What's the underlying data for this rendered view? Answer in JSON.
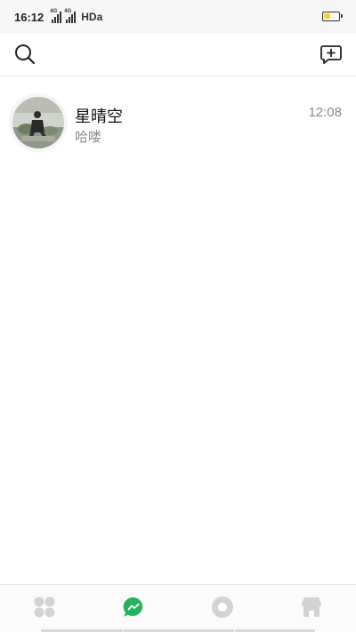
{
  "status_bar": {
    "time": "16:12",
    "network_1": "4G",
    "network_2": "4G",
    "hd_label": "HDa",
    "battery_level": 0.45,
    "battery_color": "#f3d232"
  },
  "top_bar": {
    "search_icon": "search-icon",
    "compose_icon": "new-chat-icon"
  },
  "chats": [
    {
      "name": "星晴空",
      "preview": "哈喽",
      "time": "12:08",
      "avatar": "user-avatar-photo"
    }
  ],
  "bottom_nav": {
    "items": [
      {
        "icon": "apps-icon",
        "active": false
      },
      {
        "icon": "messages-icon",
        "active": true
      },
      {
        "icon": "moments-icon",
        "active": false
      },
      {
        "icon": "store-icon",
        "active": false
      }
    ],
    "active_color": "#22b35e",
    "inactive_color": "#d3d3d3"
  }
}
